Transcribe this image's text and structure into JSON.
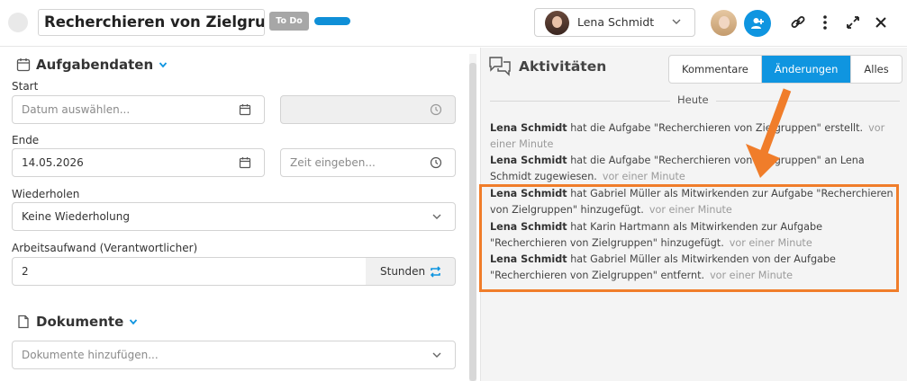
{
  "header": {
    "task_title": "Recherchieren von Zielgruppen",
    "status": "To Do",
    "progress": 1.0,
    "assignee_name": "Lena Schmidt"
  },
  "left": {
    "section_task": "Aufgabendaten",
    "start_label": "Start",
    "start_date_placeholder": "Datum auswählen...",
    "end_label": "Ende",
    "end_date_value": "14.05.2026",
    "end_time_placeholder": "Zeit eingeben...",
    "repeat_label": "Wiederholen",
    "repeat_value": "Keine Wiederholung",
    "effort_label": "Arbeitsaufwand (Verantwortlicher)",
    "effort_value": "2",
    "effort_unit": "Stunden",
    "section_docs": "Dokumente",
    "docs_placeholder": "Dokumente hinzufügen..."
  },
  "activities": {
    "title": "Aktivitäten",
    "tabs": [
      {
        "label": "Kommentare",
        "active": false
      },
      {
        "label": "Änderungen",
        "active": true
      },
      {
        "label": "Alles",
        "active": false
      }
    ],
    "day_label": "Heute",
    "entries": [
      {
        "actor": "Lena Schmidt",
        "text": "hat die Aufgabe \"Recherchieren von Zielgruppen\" erstellt.",
        "time": "vor einer Minute"
      },
      {
        "actor": "Lena Schmidt",
        "text": "hat die Aufgabe \"Recherchieren von Zielgruppen\" an Lena Schmidt zugewiesen.",
        "time": "vor einer Minute"
      },
      {
        "actor": "Lena Schmidt",
        "text": "hat Gabriel Müller als Mitwirkenden zur Aufgabe \"Recherchieren von Zielgruppen\" hinzugefügt.",
        "time": "vor einer Minute"
      },
      {
        "actor": "Lena Schmidt",
        "text": "hat Karin Hartmann als Mitwirkenden zur Aufgabe \"Recherchieren von Zielgruppen\" hinzugefügt.",
        "time": "vor einer Minute"
      },
      {
        "actor": "Lena Schmidt",
        "text": "hat Gabriel Müller als Mitwirkenden von der Aufgabe \"Recherchieren von Zielgruppen\" entfernt.",
        "time": "vor einer Minute"
      }
    ]
  },
  "colors": {
    "accent": "#0f95e0",
    "highlight": "#f07d2a",
    "badge": "#a7a7a7"
  }
}
